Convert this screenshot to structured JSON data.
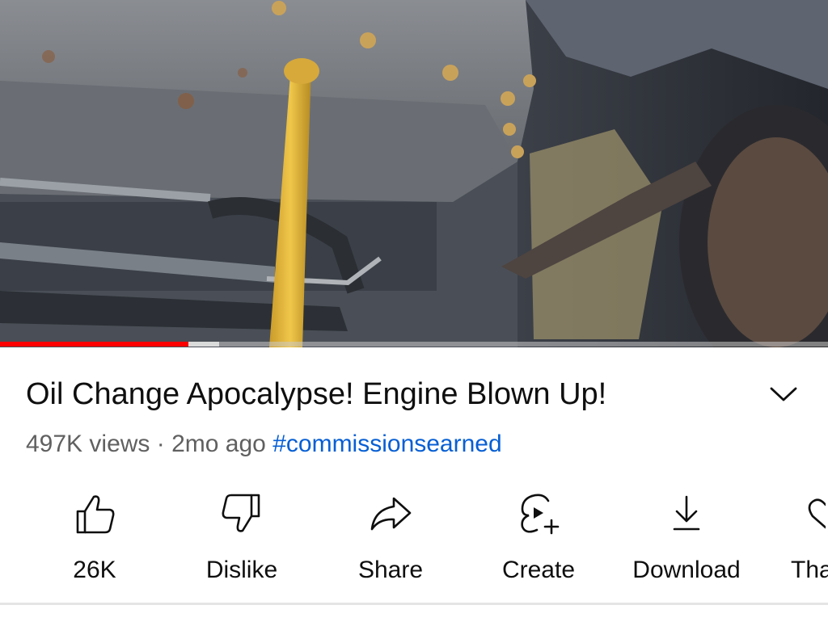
{
  "video": {
    "progress_fraction": 0.228,
    "buffered_fraction": 0.265
  },
  "title": "Oil Change Apocalypse! Engine Blown Up!",
  "meta": {
    "views": "497K views",
    "separator": "·",
    "age": "2mo ago",
    "hashtag": "#commissionsearned"
  },
  "actions": [
    {
      "label": "26K",
      "icon": "thumbs-up-icon"
    },
    {
      "label": "Dislike",
      "icon": "thumbs-down-icon"
    },
    {
      "label": "Share",
      "icon": "share-arrow-icon"
    },
    {
      "label": "Create",
      "icon": "create-remix-icon"
    },
    {
      "label": "Download",
      "icon": "download-icon"
    },
    {
      "label": "Thanks",
      "icon": "thanks-heart-icon"
    }
  ],
  "colors": {
    "progress_played": "#ff0000",
    "hashtag": "#065fd4",
    "meta_text": "#606060",
    "title_text": "#0f0f0f"
  }
}
